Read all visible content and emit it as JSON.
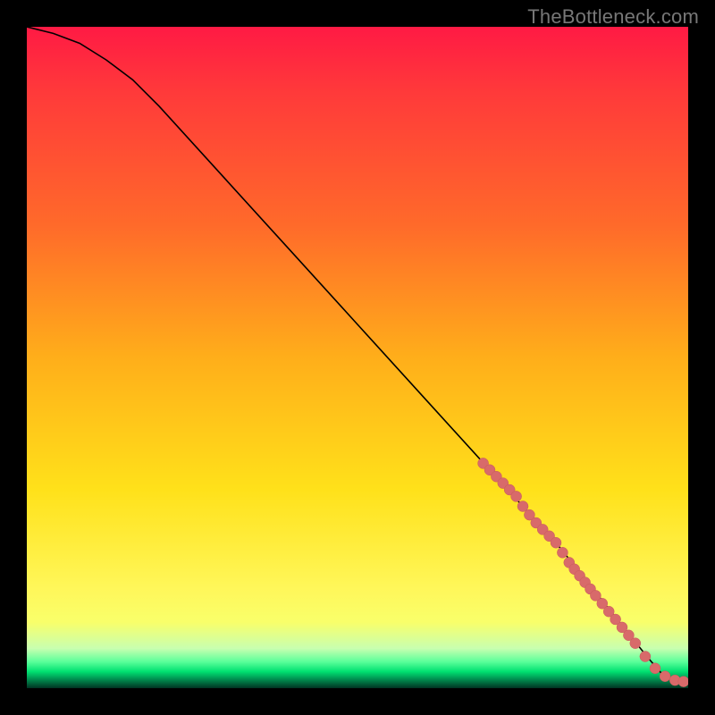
{
  "watermark": "TheBottleneck.com",
  "chart_data": {
    "type": "line",
    "title": "",
    "xlabel": "",
    "ylabel": "",
    "xlim": [
      0,
      100
    ],
    "ylim": [
      0,
      100
    ],
    "grid": false,
    "series": [
      {
        "name": "curve",
        "kind": "line",
        "x": [
          0,
          4,
          8,
          12,
          16,
          20,
          30,
          40,
          50,
          60,
          70,
          75,
          80,
          84,
          86,
          88,
          90,
          92,
          94,
          96,
          98,
          100
        ],
        "y": [
          100,
          99,
          97.5,
          95,
          92,
          88,
          77,
          66,
          55,
          44,
          33,
          27.5,
          22,
          17,
          14.5,
          12,
          9.5,
          7,
          4.5,
          2.2,
          1.2,
          1.0
        ]
      },
      {
        "name": "highlight-dots",
        "kind": "scatter",
        "x": [
          69,
          70,
          71,
          72,
          73,
          74,
          75,
          76,
          77,
          78,
          79,
          80,
          81,
          82,
          82.8,
          83.6,
          84.4,
          85.2,
          86,
          87,
          88,
          89,
          90,
          91,
          92,
          93.5,
          95,
          96.5,
          98,
          99.3
        ],
        "y": [
          34,
          33,
          32,
          31,
          30,
          29,
          27.5,
          26.2,
          25,
          24,
          23,
          22,
          20.5,
          19,
          18,
          17,
          16,
          15,
          14,
          12.8,
          11.6,
          10.4,
          9.2,
          8,
          6.8,
          4.8,
          3.0,
          1.8,
          1.2,
          1.0
        ]
      }
    ]
  }
}
